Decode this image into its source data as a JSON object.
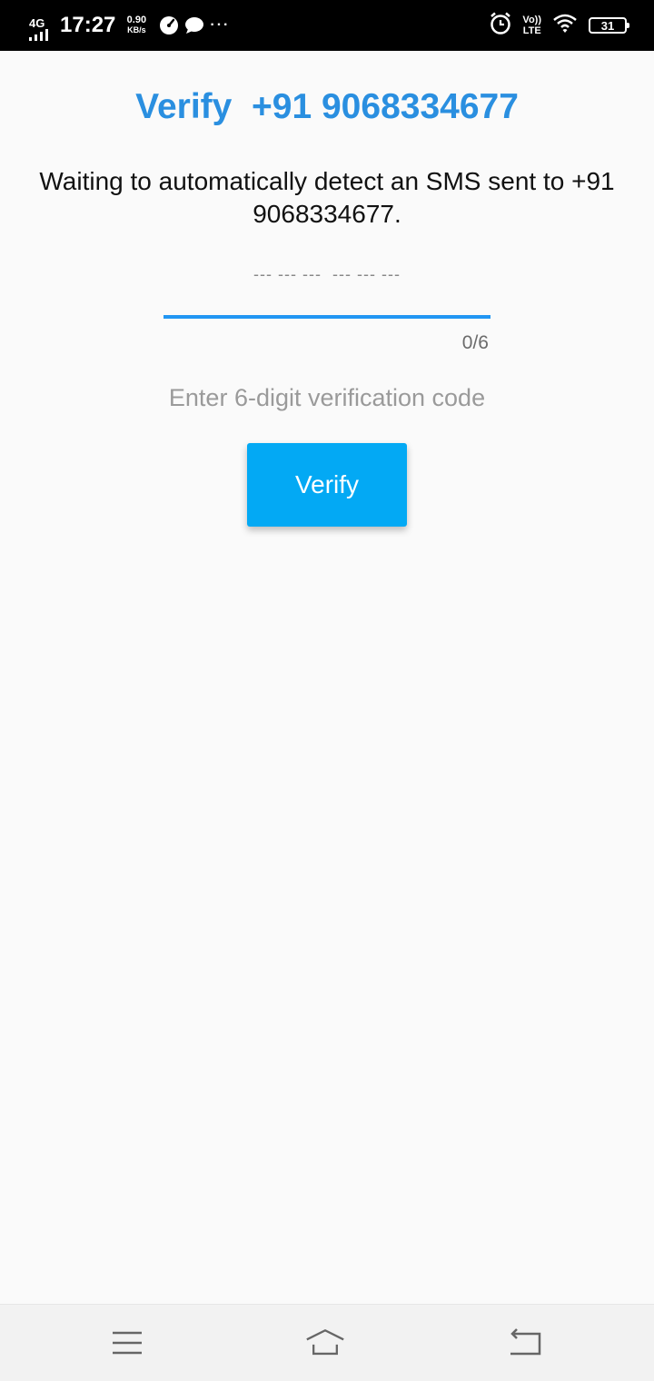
{
  "status_bar": {
    "network_type": "4G",
    "time": "17:27",
    "speed_value": "0.90",
    "speed_unit": "KB/s",
    "volte_top": "Vo))",
    "volte_bottom": "LTE",
    "battery_level": "31",
    "icons": [
      "signal-icon",
      "speedometer-icon",
      "chat-bubble-icon",
      "more-dots-icon",
      "alarm-icon",
      "volte-icon",
      "wifi-icon",
      "battery-icon"
    ]
  },
  "verify": {
    "title": "Verify  +91 9068334677",
    "waiting_text": "Waiting to automatically detect an SMS sent to +91 9068334677.",
    "code_placeholder": "--- --- ---  --- --- ---",
    "code_value": "",
    "counter": "0/6",
    "helper_text": "Enter 6-digit verification code",
    "button_label": "Verify",
    "accent_color": "#2196f3",
    "button_color": "#03a9f4"
  },
  "nav_bar": {
    "icons": [
      "menu-icon",
      "home-icon",
      "back-icon"
    ]
  }
}
